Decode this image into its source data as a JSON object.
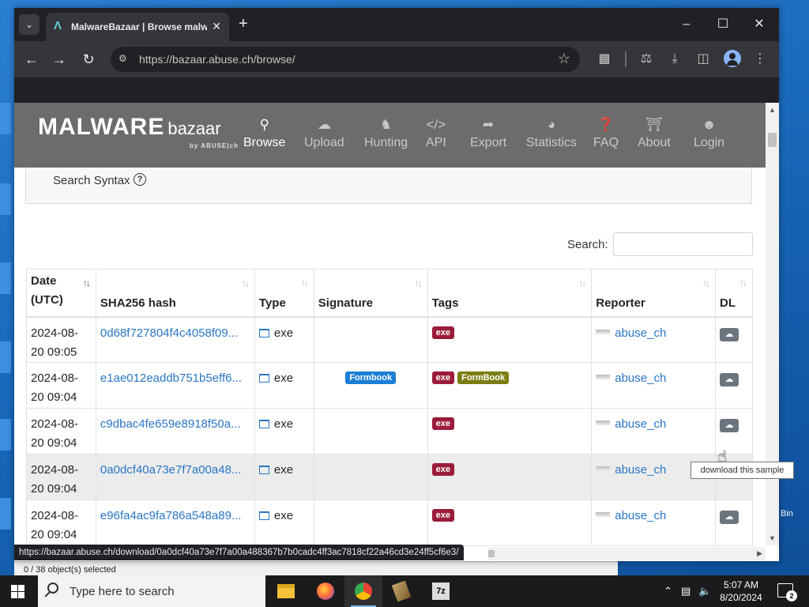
{
  "browser": {
    "tab_title": "MalwareBazaar | Browse malware",
    "url": "https://bazaar.abuse.ch/browse/",
    "status_url": "https://bazaar.abuse.ch/download/0a0dcf40a73e7f7a00a488367b7b0cadc4ff3ac7818cf22a46cd3e24ff5cf6e3/"
  },
  "site": {
    "brand_main": "MALWARE",
    "brand_sub": "bazaar",
    "brand_by": "by ABUSE|ch",
    "nav": [
      {
        "label": "Browse",
        "icon": "search-icon"
      },
      {
        "label": "Upload",
        "icon": "cloud-upload-icon"
      },
      {
        "label": "Hunting",
        "icon": "hunting-icon"
      },
      {
        "label": "API",
        "icon": "code-icon"
      },
      {
        "label": "Export",
        "icon": "export-icon"
      },
      {
        "label": "Statistics",
        "icon": "pie-chart-icon"
      },
      {
        "label": "FAQ",
        "icon": "question-icon"
      },
      {
        "label": "About",
        "icon": "building-icon"
      },
      {
        "label": "Login",
        "icon": "user-icon"
      }
    ],
    "search_syntax": "Search Syntax",
    "search_label": "Search:"
  },
  "table": {
    "headers": {
      "date": "Date (UTC)",
      "hash": "SHA256 hash",
      "type": "Type",
      "signature": "Signature",
      "tags": "Tags",
      "reporter": "Reporter",
      "dl": "DL"
    },
    "rows": [
      {
        "date1": "2024-08-",
        "date2": "20 09:05",
        "hash": "0d68f727804f4c4058f09...",
        "type": "exe",
        "signature": "",
        "tag1": "exe",
        "tag2": "",
        "reporter": "abuse_ch"
      },
      {
        "date1": "2024-08-",
        "date2": "20 09:04",
        "hash": "e1ae012eaddb751b5eff6...",
        "type": "exe",
        "signature": "Formbook",
        "tag1": "exe",
        "tag2": "FormBook",
        "reporter": "abuse_ch"
      },
      {
        "date1": "2024-08-",
        "date2": "20 09:04",
        "hash": "c9dbac4fe659e8918f50a...",
        "type": "exe",
        "signature": "",
        "tag1": "exe",
        "tag2": "",
        "reporter": "abuse_ch"
      },
      {
        "date1": "2024-08-",
        "date2": "20 09:04",
        "hash": "0a0dcf40a73e7f7a00a48...",
        "type": "exe",
        "signature": "",
        "tag1": "exe",
        "tag2": "",
        "reporter": "abuse_ch"
      },
      {
        "date1": "2024-08-",
        "date2": "20 09:04",
        "hash": "e96fa4ac9fa786a548a89...",
        "type": "exe",
        "signature": "",
        "tag1": "exe",
        "tag2": "",
        "reporter": "abuse_ch"
      }
    ]
  },
  "tooltip": "download this sample",
  "behind_window": "0 / 38 object(s) selected",
  "taskbar": {
    "search_placeholder": "Type here to search",
    "time": "5:07 AM",
    "date": "8/20/2024",
    "notifications": "2"
  },
  "desktop": {
    "bin_label": "Bin"
  },
  "colors": {
    "badge_exe": "#9b1c3a",
    "badge_formbook_sig": "#1a7fd6",
    "badge_formbook_tag": "#7d7d16",
    "navbar": "#6c6c6c",
    "link": "#2a76c6"
  }
}
